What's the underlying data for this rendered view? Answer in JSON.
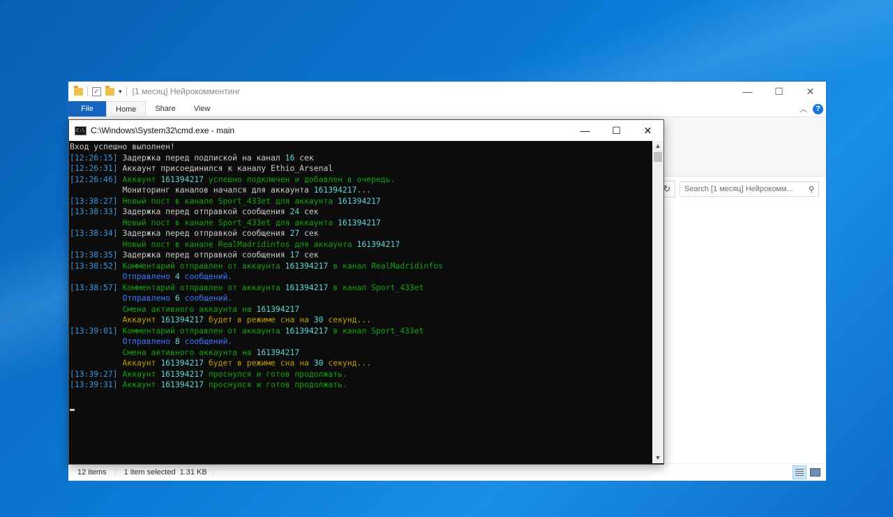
{
  "explorer": {
    "title": "[1 месяц] Нейрокомментинг",
    "tabs": [
      "File",
      "Home",
      "Share",
      "View"
    ],
    "search_placeholder": "Search [1 месяц] Нейрокомм...",
    "status": {
      "count": "12 items",
      "selected": "1 item selected",
      "size": "1.31 KB"
    }
  },
  "cmd": {
    "title": "C:\\Windows\\System32\\cmd.exe - main",
    "lines": [
      [
        {
          "t": "Вход успешно выполнен!",
          "c": "white"
        }
      ],
      [
        {
          "t": "[12:26:15] ",
          "c": "ts"
        },
        {
          "t": "Задержка перед подпиской на канал ",
          "c": "white"
        },
        {
          "t": "16",
          "c": "cyan"
        },
        {
          "t": " сек",
          "c": "white"
        }
      ],
      [
        {
          "t": "[12:26:31] ",
          "c": "ts"
        },
        {
          "t": "Аккаунт присоединился к каналу Ethio_Arsenal",
          "c": "white"
        }
      ],
      [
        {
          "t": "[12:26:46] ",
          "c": "ts"
        },
        {
          "t": "Аккаунт ",
          "c": "green"
        },
        {
          "t": "161394217",
          "c": "cyan"
        },
        {
          "t": " успешно подключен и добавлен в очередь.",
          "c": "green"
        }
      ],
      [
        {
          "t": "           ",
          "c": "white"
        },
        {
          "t": "Мониторинг каналов начался для аккаунта ",
          "c": "white"
        },
        {
          "t": "161394217...",
          "c": "cyan"
        }
      ],
      [
        {
          "t": "[13:38:27] ",
          "c": "ts"
        },
        {
          "t": "Новый пост в канале Sport_433et для аккаунта ",
          "c": "green"
        },
        {
          "t": "161394217",
          "c": "cyan"
        }
      ],
      [
        {
          "t": "[13:38:33] ",
          "c": "ts"
        },
        {
          "t": "Задержка перед отправкой сообщения ",
          "c": "white"
        },
        {
          "t": "24",
          "c": "cyan"
        },
        {
          "t": " сек",
          "c": "white"
        }
      ],
      [
        {
          "t": "           ",
          "c": "white"
        },
        {
          "t": "Новый пост в канале Sport_433et для аккаунта ",
          "c": "green"
        },
        {
          "t": "161394217",
          "c": "cyan"
        }
      ],
      [
        {
          "t": "[13:38:34] ",
          "c": "ts"
        },
        {
          "t": "Задержка перед отправкой сообщения ",
          "c": "white"
        },
        {
          "t": "27",
          "c": "cyan"
        },
        {
          "t": " сек",
          "c": "white"
        }
      ],
      [
        {
          "t": "           ",
          "c": "white"
        },
        {
          "t": "Новый пост в канале RealMadridinfos для аккаунта ",
          "c": "green"
        },
        {
          "t": "161394217",
          "c": "cyan"
        }
      ],
      [
        {
          "t": "[13:38:35] ",
          "c": "ts"
        },
        {
          "t": "Задержка перед отправкой сообщения ",
          "c": "white"
        },
        {
          "t": "17",
          "c": "cyan"
        },
        {
          "t": " сек",
          "c": "white"
        }
      ],
      [
        {
          "t": "[13:38:52] ",
          "c": "ts"
        },
        {
          "t": "Комментарий отправлен от аккаунта ",
          "c": "green"
        },
        {
          "t": "161394217",
          "c": "cyan"
        },
        {
          "t": " в канал RealMadridinfos",
          "c": "green"
        }
      ],
      [
        {
          "t": "           ",
          "c": "white"
        },
        {
          "t": "Отправлено ",
          "c": "blue"
        },
        {
          "t": "4",
          "c": "cyan"
        },
        {
          "t": " сообщений.",
          "c": "blue"
        }
      ],
      [
        {
          "t": "[13:38:57] ",
          "c": "ts"
        },
        {
          "t": "Комментарий отправлен от аккаунта ",
          "c": "green"
        },
        {
          "t": "161394217",
          "c": "cyan"
        },
        {
          "t": " в канал Sport_433et",
          "c": "green"
        }
      ],
      [
        {
          "t": "           ",
          "c": "white"
        },
        {
          "t": "Отправлено ",
          "c": "blue"
        },
        {
          "t": "6",
          "c": "cyan"
        },
        {
          "t": " сообщений.",
          "c": "blue"
        }
      ],
      [
        {
          "t": "           ",
          "c": "white"
        },
        {
          "t": "Смена активного аккаунта на ",
          "c": "green"
        },
        {
          "t": "161394217",
          "c": "cyan"
        }
      ],
      [
        {
          "t": "           ",
          "c": "white"
        },
        {
          "t": "Аккаунт ",
          "c": "yellow"
        },
        {
          "t": "161394217",
          "c": "cyan"
        },
        {
          "t": " будет в режиме сна на ",
          "c": "yellow"
        },
        {
          "t": "30",
          "c": "cyan"
        },
        {
          "t": " секунд...",
          "c": "yellow"
        }
      ],
      [
        {
          "t": "[13:39:01] ",
          "c": "ts"
        },
        {
          "t": "Комментарий отправлен от аккаунта ",
          "c": "green"
        },
        {
          "t": "161394217",
          "c": "cyan"
        },
        {
          "t": " в канал Sport_433et",
          "c": "green"
        }
      ],
      [
        {
          "t": "           ",
          "c": "white"
        },
        {
          "t": "Отправлено ",
          "c": "blue"
        },
        {
          "t": "8",
          "c": "cyan"
        },
        {
          "t": " сообщений.",
          "c": "blue"
        }
      ],
      [
        {
          "t": "           ",
          "c": "white"
        },
        {
          "t": "Смена активного аккаунта на ",
          "c": "green"
        },
        {
          "t": "161394217",
          "c": "cyan"
        }
      ],
      [
        {
          "t": "           ",
          "c": "white"
        },
        {
          "t": "Аккаунт ",
          "c": "yellow"
        },
        {
          "t": "161394217",
          "c": "cyan"
        },
        {
          "t": " будет в режиме сна на ",
          "c": "yellow"
        },
        {
          "t": "30",
          "c": "cyan"
        },
        {
          "t": " секунд...",
          "c": "yellow"
        }
      ],
      [
        {
          "t": "[13:39:27] ",
          "c": "ts"
        },
        {
          "t": "Аккаунт ",
          "c": "green"
        },
        {
          "t": "161394217",
          "c": "cyan"
        },
        {
          "t": " проснулся и готов продолжать.",
          "c": "green"
        }
      ],
      [
        {
          "t": "[13:39:31] ",
          "c": "ts"
        },
        {
          "t": "Аккаунт ",
          "c": "green"
        },
        {
          "t": "161394217",
          "c": "cyan"
        },
        {
          "t": " проснулся и готов продолжать.",
          "c": "green"
        }
      ]
    ]
  }
}
